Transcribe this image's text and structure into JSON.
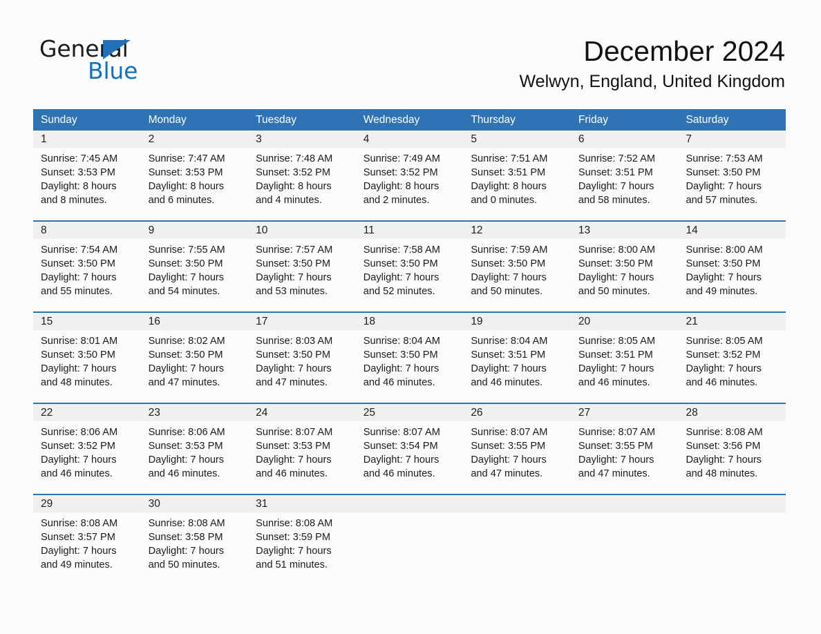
{
  "brand": {
    "name_part1": "General",
    "name_part2": "Blue",
    "accent_color": "#1271c0",
    "triangle_color": "#1f72b8"
  },
  "header": {
    "title": "December 2024",
    "location": "Welwyn, England, United Kingdom"
  },
  "theme": {
    "header_blue": "#2f73b4",
    "row_rule_blue": "#2f73b4",
    "daynum_band": "#f0f0f0",
    "page_background": "#fbfbfb"
  },
  "weekdays": [
    "Sunday",
    "Monday",
    "Tuesday",
    "Wednesday",
    "Thursday",
    "Friday",
    "Saturday"
  ],
  "weeks": [
    {
      "days": [
        {
          "num": "1",
          "l1": "Sunrise: 7:45 AM",
          "l2": "Sunset: 3:53 PM",
          "l3": "Daylight: 8 hours",
          "l4": "and 8 minutes."
        },
        {
          "num": "2",
          "l1": "Sunrise: 7:47 AM",
          "l2": "Sunset: 3:53 PM",
          "l3": "Daylight: 8 hours",
          "l4": "and 6 minutes."
        },
        {
          "num": "3",
          "l1": "Sunrise: 7:48 AM",
          "l2": "Sunset: 3:52 PM",
          "l3": "Daylight: 8 hours",
          "l4": "and 4 minutes."
        },
        {
          "num": "4",
          "l1": "Sunrise: 7:49 AM",
          "l2": "Sunset: 3:52 PM",
          "l3": "Daylight: 8 hours",
          "l4": "and 2 minutes."
        },
        {
          "num": "5",
          "l1": "Sunrise: 7:51 AM",
          "l2": "Sunset: 3:51 PM",
          "l3": "Daylight: 8 hours",
          "l4": "and 0 minutes."
        },
        {
          "num": "6",
          "l1": "Sunrise: 7:52 AM",
          "l2": "Sunset: 3:51 PM",
          "l3": "Daylight: 7 hours",
          "l4": "and 58 minutes."
        },
        {
          "num": "7",
          "l1": "Sunrise: 7:53 AM",
          "l2": "Sunset: 3:50 PM",
          "l3": "Daylight: 7 hours",
          "l4": "and 57 minutes."
        }
      ]
    },
    {
      "days": [
        {
          "num": "8",
          "l1": "Sunrise: 7:54 AM",
          "l2": "Sunset: 3:50 PM",
          "l3": "Daylight: 7 hours",
          "l4": "and 55 minutes."
        },
        {
          "num": "9",
          "l1": "Sunrise: 7:55 AM",
          "l2": "Sunset: 3:50 PM",
          "l3": "Daylight: 7 hours",
          "l4": "and 54 minutes."
        },
        {
          "num": "10",
          "l1": "Sunrise: 7:57 AM",
          "l2": "Sunset: 3:50 PM",
          "l3": "Daylight: 7 hours",
          "l4": "and 53 minutes."
        },
        {
          "num": "11",
          "l1": "Sunrise: 7:58 AM",
          "l2": "Sunset: 3:50 PM",
          "l3": "Daylight: 7 hours",
          "l4": "and 52 minutes."
        },
        {
          "num": "12",
          "l1": "Sunrise: 7:59 AM",
          "l2": "Sunset: 3:50 PM",
          "l3": "Daylight: 7 hours",
          "l4": "and 50 minutes."
        },
        {
          "num": "13",
          "l1": "Sunrise: 8:00 AM",
          "l2": "Sunset: 3:50 PM",
          "l3": "Daylight: 7 hours",
          "l4": "and 50 minutes."
        },
        {
          "num": "14",
          "l1": "Sunrise: 8:00 AM",
          "l2": "Sunset: 3:50 PM",
          "l3": "Daylight: 7 hours",
          "l4": "and 49 minutes."
        }
      ]
    },
    {
      "days": [
        {
          "num": "15",
          "l1": "Sunrise: 8:01 AM",
          "l2": "Sunset: 3:50 PM",
          "l3": "Daylight: 7 hours",
          "l4": "and 48 minutes."
        },
        {
          "num": "16",
          "l1": "Sunrise: 8:02 AM",
          "l2": "Sunset: 3:50 PM",
          "l3": "Daylight: 7 hours",
          "l4": "and 47 minutes."
        },
        {
          "num": "17",
          "l1": "Sunrise: 8:03 AM",
          "l2": "Sunset: 3:50 PM",
          "l3": "Daylight: 7 hours",
          "l4": "and 47 minutes."
        },
        {
          "num": "18",
          "l1": "Sunrise: 8:04 AM",
          "l2": "Sunset: 3:50 PM",
          "l3": "Daylight: 7 hours",
          "l4": "and 46 minutes."
        },
        {
          "num": "19",
          "l1": "Sunrise: 8:04 AM",
          "l2": "Sunset: 3:51 PM",
          "l3": "Daylight: 7 hours",
          "l4": "and 46 minutes."
        },
        {
          "num": "20",
          "l1": "Sunrise: 8:05 AM",
          "l2": "Sunset: 3:51 PM",
          "l3": "Daylight: 7 hours",
          "l4": "and 46 minutes."
        },
        {
          "num": "21",
          "l1": "Sunrise: 8:05 AM",
          "l2": "Sunset: 3:52 PM",
          "l3": "Daylight: 7 hours",
          "l4": "and 46 minutes."
        }
      ]
    },
    {
      "days": [
        {
          "num": "22",
          "l1": "Sunrise: 8:06 AM",
          "l2": "Sunset: 3:52 PM",
          "l3": "Daylight: 7 hours",
          "l4": "and 46 minutes."
        },
        {
          "num": "23",
          "l1": "Sunrise: 8:06 AM",
          "l2": "Sunset: 3:53 PM",
          "l3": "Daylight: 7 hours",
          "l4": "and 46 minutes."
        },
        {
          "num": "24",
          "l1": "Sunrise: 8:07 AM",
          "l2": "Sunset: 3:53 PM",
          "l3": "Daylight: 7 hours",
          "l4": "and 46 minutes."
        },
        {
          "num": "25",
          "l1": "Sunrise: 8:07 AM",
          "l2": "Sunset: 3:54 PM",
          "l3": "Daylight: 7 hours",
          "l4": "and 46 minutes."
        },
        {
          "num": "26",
          "l1": "Sunrise: 8:07 AM",
          "l2": "Sunset: 3:55 PM",
          "l3": "Daylight: 7 hours",
          "l4": "and 47 minutes."
        },
        {
          "num": "27",
          "l1": "Sunrise: 8:07 AM",
          "l2": "Sunset: 3:55 PM",
          "l3": "Daylight: 7 hours",
          "l4": "and 47 minutes."
        },
        {
          "num": "28",
          "l1": "Sunrise: 8:08 AM",
          "l2": "Sunset: 3:56 PM",
          "l3": "Daylight: 7 hours",
          "l4": "and 48 minutes."
        }
      ]
    },
    {
      "days": [
        {
          "num": "29",
          "l1": "Sunrise: 8:08 AM",
          "l2": "Sunset: 3:57 PM",
          "l3": "Daylight: 7 hours",
          "l4": "and 49 minutes."
        },
        {
          "num": "30",
          "l1": "Sunrise: 8:08 AM",
          "l2": "Sunset: 3:58 PM",
          "l3": "Daylight: 7 hours",
          "l4": "and 50 minutes."
        },
        {
          "num": "31",
          "l1": "Sunrise: 8:08 AM",
          "l2": "Sunset: 3:59 PM",
          "l3": "Daylight: 7 hours",
          "l4": "and 51 minutes."
        },
        {
          "num": "",
          "l1": "",
          "l2": "",
          "l3": "",
          "l4": ""
        },
        {
          "num": "",
          "l1": "",
          "l2": "",
          "l3": "",
          "l4": ""
        },
        {
          "num": "",
          "l1": "",
          "l2": "",
          "l3": "",
          "l4": ""
        },
        {
          "num": "",
          "l1": "",
          "l2": "",
          "l3": "",
          "l4": ""
        }
      ]
    }
  ]
}
